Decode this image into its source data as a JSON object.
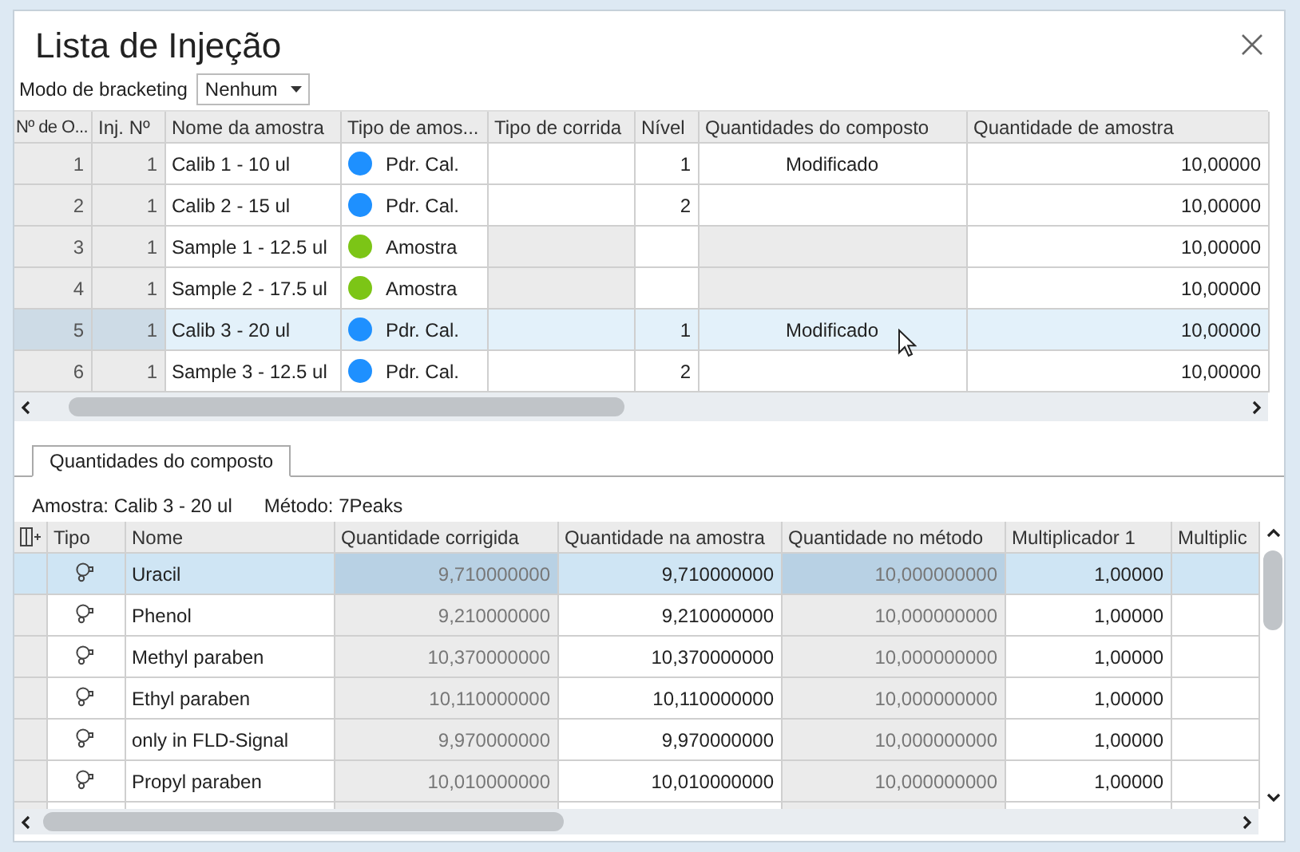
{
  "window": {
    "title": "Lista de Injeção"
  },
  "bracketing": {
    "label": "Modo de bracketing",
    "value": "Nenhum"
  },
  "injections": {
    "columns": [
      "Nº de O...",
      "Inj. Nº",
      "Nome da amostra",
      "Tipo de amos...",
      "Tipo de corrida",
      "Nível",
      "Quantidades do composto",
      "Quantidade de amostra"
    ],
    "rows": [
      {
        "order": "1",
        "inj": "1",
        "name": "Calib 1 - 10 ul",
        "color": "#1e90ff",
        "type": "Pdr. Cal.",
        "kind": "calibration",
        "level": "1",
        "compound": "Modificado",
        "amount": "10,00000",
        "selected": false
      },
      {
        "order": "2",
        "inj": "1",
        "name": "Calib 2 - 15 ul",
        "color": "#1e90ff",
        "type": "Pdr. Cal.",
        "kind": "calibration",
        "level": "2",
        "compound": "",
        "amount": "10,00000",
        "selected": false
      },
      {
        "order": "3",
        "inj": "1",
        "name": "Sample 1 - 12.5 ul",
        "color": "#7cc516",
        "type": "Amostra",
        "kind": "sample",
        "level": "",
        "compound": "",
        "amount": "10,00000",
        "selected": false
      },
      {
        "order": "4",
        "inj": "1",
        "name": "Sample 2 - 17.5 ul",
        "color": "#7cc516",
        "type": "Amostra",
        "kind": "sample",
        "level": "",
        "compound": "",
        "amount": "10,00000",
        "selected": false
      },
      {
        "order": "5",
        "inj": "1",
        "name": "Calib 3 - 20 ul",
        "color": "#1e90ff",
        "type": "Pdr. Cal.",
        "kind": "calibration",
        "level": "1",
        "compound": "Modificado",
        "amount": "10,00000",
        "selected": true
      },
      {
        "order": "6",
        "inj": "1",
        "name": "Sample 3 - 12.5 ul",
        "color": "#1e90ff",
        "type": "Pdr. Cal.",
        "kind": "calibration",
        "level": "2",
        "compound": "",
        "amount": "10,00000",
        "selected": false
      }
    ]
  },
  "tabs": [
    {
      "label": "Quantidades do composto",
      "selected": true
    }
  ],
  "info": {
    "sample": "Amostra: Calib 3 - 20 ul",
    "method": "Método: 7Peaks"
  },
  "compounds": {
    "columns": [
      {
        "label": "Tipo",
        "readonly": false
      },
      {
        "label": "Nome",
        "readonly": false
      },
      {
        "label": "Quantidade corrigida",
        "readonly": true
      },
      {
        "label": "Quantidade na amostra",
        "readonly": false
      },
      {
        "label": "Quantidade no método",
        "readonly": true
      },
      {
        "label": "Multiplicador 1",
        "readonly": false
      },
      {
        "label": "Multiplic",
        "readonly": false
      }
    ],
    "rows": [
      {
        "name": "Uracil",
        "corrected": "9,710000000",
        "in_sample": "9,710000000",
        "in_method": "10,000000000",
        "mult1": "1,00000",
        "selected": true
      },
      {
        "name": "Phenol",
        "corrected": "9,210000000",
        "in_sample": "9,210000000",
        "in_method": "10,000000000",
        "mult1": "1,00000",
        "selected": false
      },
      {
        "name": "Methyl paraben",
        "corrected": "10,370000000",
        "in_sample": "10,370000000",
        "in_method": "10,000000000",
        "mult1": "1,00000",
        "selected": false
      },
      {
        "name": "Ethyl paraben",
        "corrected": "10,110000000",
        "in_sample": "10,110000000",
        "in_method": "10,000000000",
        "mult1": "1,00000",
        "selected": false
      },
      {
        "name": "only in FLD-Signal",
        "corrected": "9,970000000",
        "in_sample": "9,970000000",
        "in_method": "10,000000000",
        "mult1": "1,00000",
        "selected": false
      },
      {
        "name": "Propyl paraben",
        "corrected": "10,010000000",
        "in_sample": "10,010000000",
        "in_method": "10,000000000",
        "mult1": "1,00000",
        "selected": false
      }
    ]
  }
}
